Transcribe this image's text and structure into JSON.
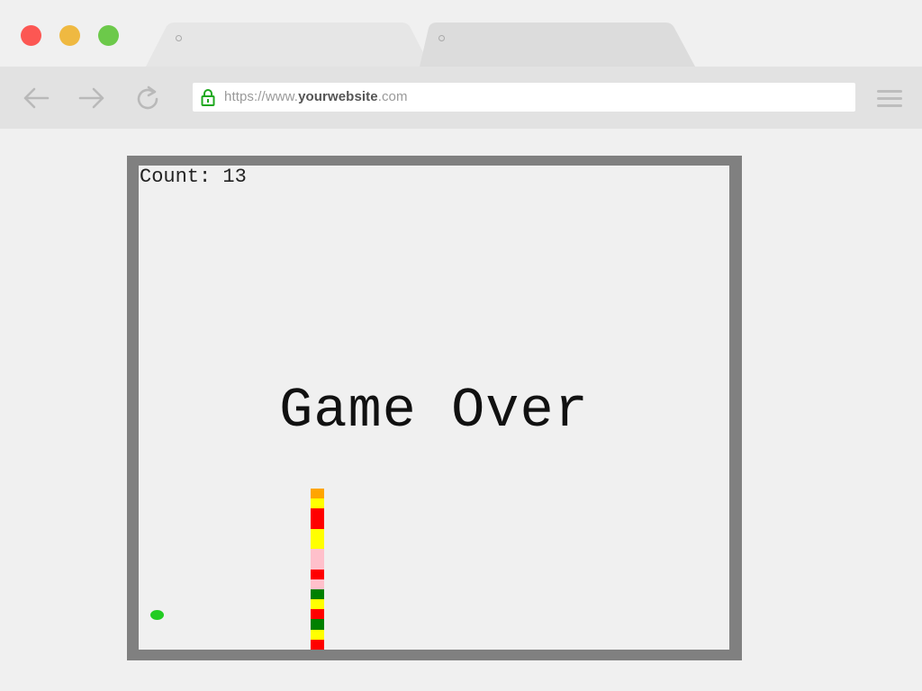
{
  "browser": {
    "traffic_lights": {
      "close_color": "#fc5753",
      "minimize_color": "#efb941",
      "maximize_color": "#6cc94a"
    },
    "tabs": [
      {
        "label": "",
        "active": true
      },
      {
        "label": "",
        "active": false
      }
    ],
    "url": {
      "scheme": "https://www.",
      "domain": "yourwebsite",
      "tld": ".com"
    },
    "icons": {
      "back": "arrow-left-icon",
      "forward": "arrow-right-icon",
      "reload": "reload-icon",
      "lock": "lock-icon",
      "menu": "hamburger-menu-icon"
    }
  },
  "game": {
    "count_label": "Count: 13",
    "message": "Game Over",
    "frame_color": "#808080",
    "snake_colors": [
      "orange",
      "yellow",
      "red",
      "red",
      "yellow",
      "yellow",
      "pink",
      "pink",
      "red",
      "pink",
      "green",
      "yellow",
      "red",
      "green",
      "yellow",
      "red"
    ],
    "food_color": "#22cc22"
  }
}
